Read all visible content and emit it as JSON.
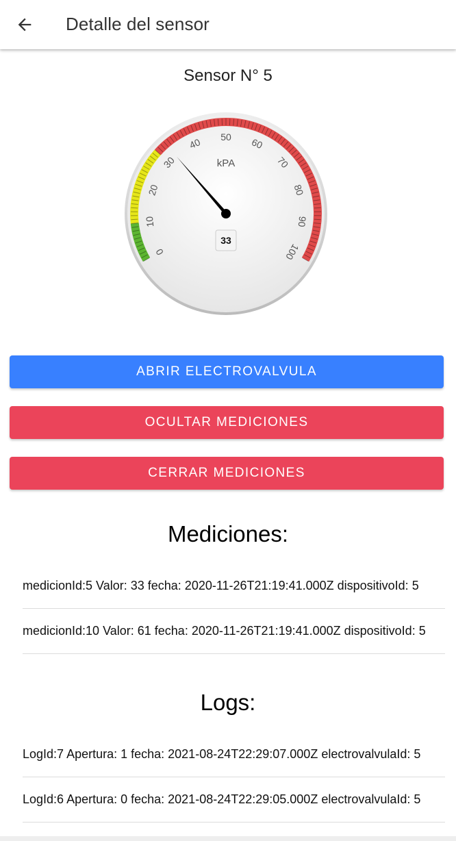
{
  "header": {
    "title": "Detalle del sensor",
    "back_icon": "arrow-back-icon"
  },
  "sensor": {
    "title": "Sensor N° 5"
  },
  "gauge": {
    "units": "kPA",
    "value": 33,
    "value_text": "33",
    "min": 0,
    "max": 100,
    "ticks": [
      "0",
      "10",
      "20",
      "30",
      "40",
      "50",
      "60",
      "70",
      "80",
      "90",
      "100"
    ],
    "bands": [
      {
        "from": 0,
        "to": 10,
        "color": "#5cb531"
      },
      {
        "from": 10,
        "to": 30,
        "color": "#e6e619"
      },
      {
        "from": 30,
        "to": 100,
        "color": "#e04a4a"
      }
    ]
  },
  "buttons": {
    "open_valve": "ABRIR ELECTROVALVULA",
    "hide_measurements": "OCULTAR MEDICIONES",
    "close_measurements": "CERRAR MEDICIONES"
  },
  "colors": {
    "primary": "#3880ff",
    "danger": "#eb445a"
  },
  "mediciones": {
    "title": "Mediciones:",
    "items": [
      "medicionId:5 Valor: 33 fecha: 2020-11-26T21:19:41.000Z dispositivoId: 5",
      "medicionId:10 Valor: 61 fecha: 2020-11-26T21:19:41.000Z dispositivoId: 5"
    ]
  },
  "logs": {
    "title": "Logs:",
    "items": [
      "LogId:7 Apertura: 1 fecha: 2021-08-24T22:29:07.000Z electrovalvulaId: 5",
      "LogId:6 Apertura: 0 fecha: 2021-08-24T22:29:05.000Z electrovalvulaId: 5"
    ]
  }
}
